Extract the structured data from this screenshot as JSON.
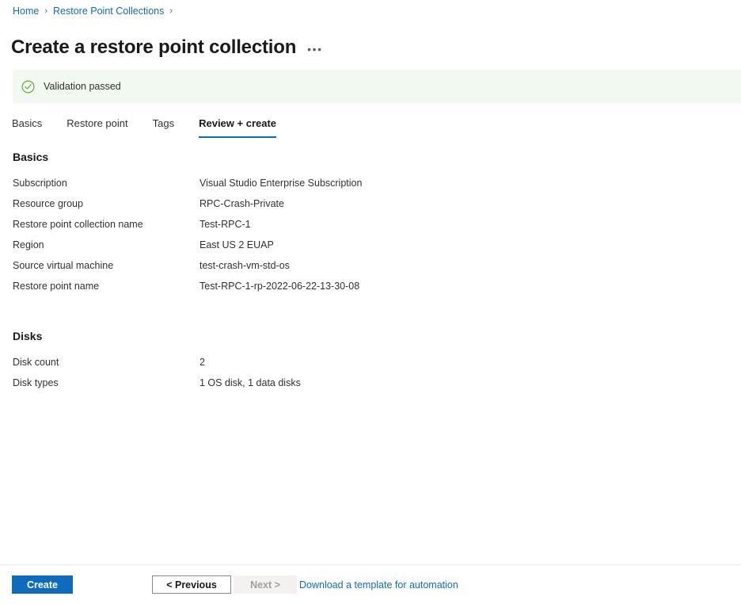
{
  "breadcrumb": {
    "items": [
      {
        "label": "Home"
      },
      {
        "label": "Restore Point Collections"
      }
    ],
    "separator": "›"
  },
  "header": {
    "title": "Create a restore point collection",
    "more_label": "•••"
  },
  "banner": {
    "text": "Validation passed",
    "icon": "check-circle-icon",
    "background": "#f2f9f1",
    "icon_color": "#6ba43a"
  },
  "tabs": [
    {
      "label": "Basics",
      "active": false
    },
    {
      "label": "Restore point",
      "active": false
    },
    {
      "label": "Tags",
      "active": false
    },
    {
      "label": "Review + create",
      "active": true
    }
  ],
  "sections": [
    {
      "heading": "Basics",
      "rows": [
        {
          "key": "Subscription",
          "value": "Visual Studio Enterprise Subscription"
        },
        {
          "key": "Resource group",
          "value": "RPC-Crash-Private"
        },
        {
          "key": "Restore point collection name",
          "value": "Test-RPC-1"
        },
        {
          "key": "Region",
          "value": "East US 2 EUAP"
        },
        {
          "key": "Source virtual machine",
          "value": "test-crash-vm-std-os"
        },
        {
          "key": "Restore point name",
          "value": "Test-RPC-1-rp-2022-06-22-13-30-08"
        }
      ]
    },
    {
      "heading": "Disks",
      "rows": [
        {
          "key": "Disk count",
          "value": "2"
        },
        {
          "key": "Disk types",
          "value": "1 OS disk, 1 data disks"
        }
      ]
    }
  ],
  "footer": {
    "create_label": "Create",
    "previous_label": "< Previous",
    "next_label": "Next >",
    "download_link_label": "Download a template for automation"
  },
  "colors": {
    "accent": "#0f6cbd",
    "link": "#0f6cbd",
    "success": "#6ba43a",
    "text": "#323130"
  }
}
